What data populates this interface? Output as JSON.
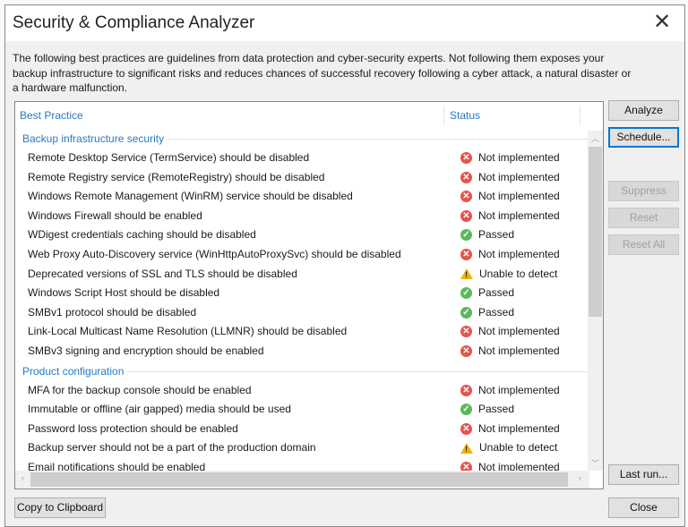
{
  "dialog": {
    "title": "Security & Compliance Analyzer",
    "description": "The following best practices are guidelines from data protection and cyber-security experts. Not following them exposes your backup infrastructure to significant risks and reduces chances of successful recovery following a cyber attack, a natural disaster or a hardware malfunction."
  },
  "table": {
    "columns": [
      "Best Practice",
      "Status"
    ],
    "groups": [
      {
        "label": "Backup infrastructure security",
        "rows": [
          {
            "name": "Remote Desktop Service (TermService) should be disabled",
            "status": "Not implemented",
            "icon": "x"
          },
          {
            "name": "Remote Registry service (RemoteRegistry) should be disabled",
            "status": "Not implemented",
            "icon": "x"
          },
          {
            "name": "Windows Remote Management (WinRM) service should be disabled",
            "status": "Not implemented",
            "icon": "x"
          },
          {
            "name": "Windows Firewall should be enabled",
            "status": "Not implemented",
            "icon": "x"
          },
          {
            "name": "WDigest credentials caching should be disabled",
            "status": "Passed",
            "icon": "ok"
          },
          {
            "name": "Web Proxy Auto-Discovery service (WinHttpAutoProxySvc) should be disabled",
            "status": "Not implemented",
            "icon": "x"
          },
          {
            "name": "Deprecated versions of SSL and TLS should be disabled",
            "status": "Unable to detect",
            "icon": "w"
          },
          {
            "name": "Windows Script Host should be disabled",
            "status": "Passed",
            "icon": "ok"
          },
          {
            "name": "SMBv1 protocol should be disabled",
            "status": "Passed",
            "icon": "ok"
          },
          {
            "name": "Link-Local Multicast Name Resolution (LLMNR) should be disabled",
            "status": "Not implemented",
            "icon": "x"
          },
          {
            "name": "SMBv3 signing and encryption should be enabled",
            "status": "Not implemented",
            "icon": "x"
          }
        ]
      },
      {
        "label": "Product configuration",
        "rows": [
          {
            "name": "MFA for the backup console should be enabled",
            "status": "Not implemented",
            "icon": "x"
          },
          {
            "name": "Immutable or offline (air gapped) media should be used",
            "status": "Passed",
            "icon": "ok"
          },
          {
            "name": "Password loss protection should be enabled",
            "status": "Not implemented",
            "icon": "x"
          },
          {
            "name": "Backup server should not be a part of the production domain",
            "status": "Unable to detect",
            "icon": "w"
          },
          {
            "name": "Email notifications should be enabled",
            "status": "Not implemented",
            "icon": "x"
          }
        ]
      }
    ]
  },
  "buttons": {
    "analyze": "Analyze",
    "schedule": "Schedule...",
    "suppress": "Suppress",
    "reset": "Reset",
    "reset_all": "Reset All",
    "last_run": "Last run...",
    "close": "Close",
    "copy": "Copy to Clipboard"
  }
}
